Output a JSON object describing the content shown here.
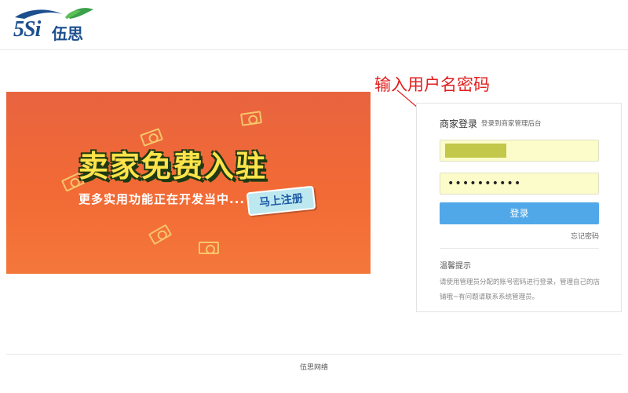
{
  "header": {
    "logo_number": "5Si",
    "logo_text": "伍思"
  },
  "annotation": {
    "text": "输入用户名密码",
    "color": "#e21e1e"
  },
  "banner": {
    "title": "卖家免费入驻",
    "subtitle": "更多实用功能正在开发当中...",
    "button_label": "马上注册"
  },
  "login": {
    "title": "商家登录",
    "subtitle": "登录到商家管理后台",
    "username_value": "",
    "password_value": "••••••••••",
    "submit_label": "登录",
    "forgot_label": "忘记密码",
    "accent_color": "#51a8e9",
    "input_bg_color": "#fbfcc9"
  },
  "tips": {
    "title": "温馨提示",
    "body": "请使用管理员分配的账号密码进行登录，管理自己的店铺哦~有问题请联系系统管理员。"
  },
  "footer": {
    "text": "伍思网络"
  }
}
